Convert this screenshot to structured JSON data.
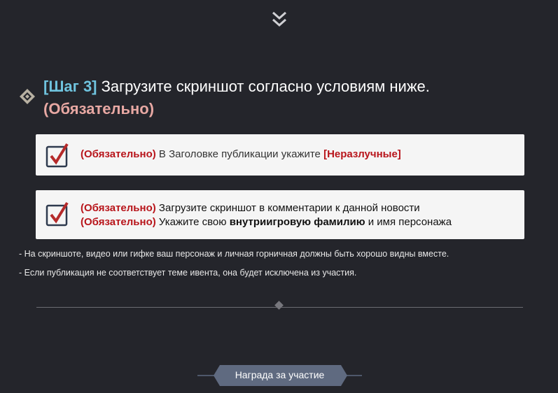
{
  "step": {
    "tag": "[Шаг 3]",
    "title": " Загрузите скриншот согласно условиям ниже.",
    "required": "(Обязательно)"
  },
  "cards": [
    {
      "lines": [
        {
          "req": "(Обязательно)",
          "text": " В Заголовке публикации укажите ",
          "highlight": "[Неразлучные]"
        }
      ]
    },
    {
      "lines": [
        {
          "req": "(Обязательно)",
          "text": " Загрузите скриншот в комментарии к данной новости"
        },
        {
          "req": "(Обязательно)",
          "text": " Укажите свою ",
          "bold": "внутриигровую фамилию",
          "after": " и имя персонажа"
        }
      ]
    }
  ],
  "notes": [
    "- На скриншоте, видео или гифке ваш персонаж и личная горничная должны быть хорошо видны вместе.",
    "- Если публикация не соответствует теме ивента, она будет исключена из участия."
  ],
  "reward_button": "Награда за участие",
  "colors": {
    "accent": "#6fc3de",
    "required": "#b8151b",
    "background": "#24252b"
  }
}
